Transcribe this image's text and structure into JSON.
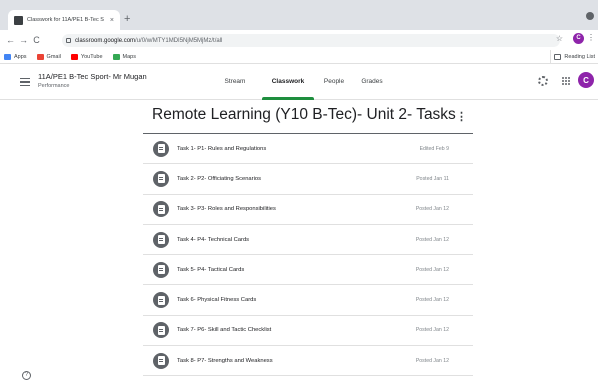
{
  "browser": {
    "tab_title": "Classwork for 11A/PE1 B-Tec S",
    "tab_close": "×",
    "new_tab": "+",
    "back": "←",
    "forward": "→",
    "reload": "C",
    "url_host": "classroom.google.com",
    "url_path": "/u/0/w/MTY1MDI5NjM5MjMz/t/all",
    "star": "☆",
    "profile_initial": "C",
    "menu": "⋮",
    "bookmarks": [
      {
        "label": "Apps",
        "color": "#4285f4"
      },
      {
        "label": "Gmail",
        "color": "#ea4335"
      },
      {
        "label": "YouTube",
        "color": "#ff0000"
      },
      {
        "label": "Maps",
        "color": "#34a853"
      }
    ],
    "reading_list": "Reading List"
  },
  "header": {
    "class_title": "11A/PE1 B-Tec Sport- Mr Mugan",
    "class_subtitle": "Performance",
    "tabs": [
      {
        "label": "Stream"
      },
      {
        "label": "Classwork",
        "active": true
      },
      {
        "label": "People"
      },
      {
        "label": "Grades"
      }
    ],
    "avatar_initial": "C",
    "accent_color": "#1e8e3e"
  },
  "topic": {
    "title": "Remote Learning (Y10 B-Tec)- Unit 2- Tasks",
    "menu": "⋮",
    "assignments": [
      {
        "title": "Task 1- P1- Rules and Regulations",
        "date": "Edited Feb 9"
      },
      {
        "title": "Task 2- P2- Officiating Scenarios",
        "date": "Posted Jan 11"
      },
      {
        "title": "Task 3- P3- Roles and Responsibilities",
        "date": "Posted Jan 12"
      },
      {
        "title": "Task 4- P4- Technical Cards",
        "date": "Posted Jan 12"
      },
      {
        "title": "Task 5- P4- Tactical Cards",
        "date": "Posted Jan 12"
      },
      {
        "title": "Task 6- Physical Fitness Cards",
        "date": "Posted Jan 12"
      },
      {
        "title": "Task 7- P6- Skill and Tactic Checklist",
        "date": "Posted Jan 12"
      },
      {
        "title": "Task 8- P7- Strengths and Weakness",
        "date": "Posted Jan 12"
      }
    ]
  },
  "help": "?"
}
